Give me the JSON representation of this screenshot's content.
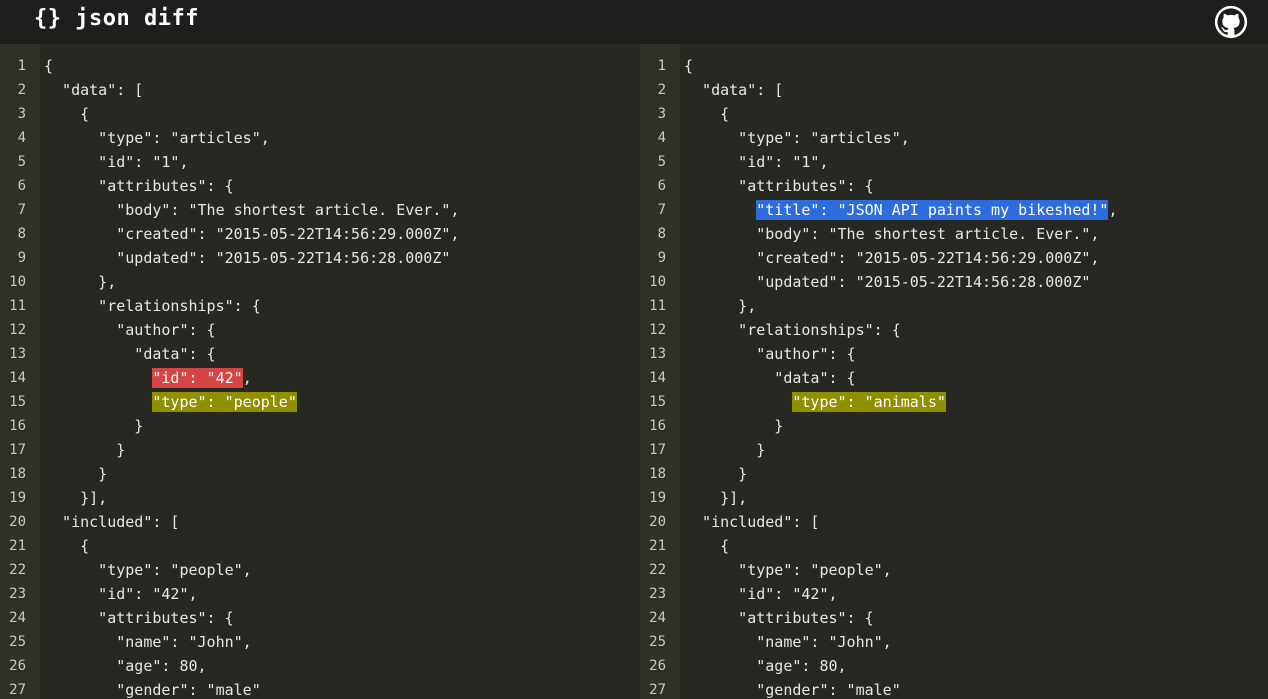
{
  "header": {
    "title": "{} json diff",
    "github_icon": "github-icon"
  },
  "colors": {
    "removed": "#d64545",
    "changed": "#8f8f00",
    "added": "#2d6cdf",
    "background": "#272822"
  },
  "left_pane": {
    "lines": [
      {
        "n": "1",
        "pre": "{",
        "hl": "",
        "post": "",
        "kind": ""
      },
      {
        "n": "2",
        "pre": "  \"data\": [",
        "hl": "",
        "post": "",
        "kind": ""
      },
      {
        "n": "3",
        "pre": "    {",
        "hl": "",
        "post": "",
        "kind": ""
      },
      {
        "n": "4",
        "pre": "      \"type\": \"articles\",",
        "hl": "",
        "post": "",
        "kind": ""
      },
      {
        "n": "5",
        "pre": "      \"id\": \"1\",",
        "hl": "",
        "post": "",
        "kind": ""
      },
      {
        "n": "6",
        "pre": "      \"attributes\": {",
        "hl": "",
        "post": "",
        "kind": ""
      },
      {
        "n": "7",
        "pre": "        \"body\": \"The shortest article. Ever.\",",
        "hl": "",
        "post": "",
        "kind": ""
      },
      {
        "n": "8",
        "pre": "        \"created\": \"2015-05-22T14:56:29.000Z\",",
        "hl": "",
        "post": "",
        "kind": ""
      },
      {
        "n": "9",
        "pre": "        \"updated\": \"2015-05-22T14:56:28.000Z\"",
        "hl": "",
        "post": "",
        "kind": ""
      },
      {
        "n": "10",
        "pre": "      },",
        "hl": "",
        "post": "",
        "kind": ""
      },
      {
        "n": "11",
        "pre": "      \"relationships\": {",
        "hl": "",
        "post": "",
        "kind": ""
      },
      {
        "n": "12",
        "pre": "        \"author\": {",
        "hl": "",
        "post": "",
        "kind": ""
      },
      {
        "n": "13",
        "pre": "          \"data\": {",
        "hl": "",
        "post": "",
        "kind": ""
      },
      {
        "n": "14",
        "pre": "            ",
        "hl": "\"id\": \"42\"",
        "post": ",",
        "kind": "removed"
      },
      {
        "n": "15",
        "pre": "            ",
        "hl": "\"type\": \"people\"",
        "post": "",
        "kind": "changed"
      },
      {
        "n": "16",
        "pre": "          }",
        "hl": "",
        "post": "",
        "kind": ""
      },
      {
        "n": "17",
        "pre": "        }",
        "hl": "",
        "post": "",
        "kind": ""
      },
      {
        "n": "18",
        "pre": "      }",
        "hl": "",
        "post": "",
        "kind": ""
      },
      {
        "n": "19",
        "pre": "    }],",
        "hl": "",
        "post": "",
        "kind": ""
      },
      {
        "n": "20",
        "pre": "  \"included\": [",
        "hl": "",
        "post": "",
        "kind": ""
      },
      {
        "n": "21",
        "pre": "    {",
        "hl": "",
        "post": "",
        "kind": ""
      },
      {
        "n": "22",
        "pre": "      \"type\": \"people\",",
        "hl": "",
        "post": "",
        "kind": ""
      },
      {
        "n": "23",
        "pre": "      \"id\": \"42\",",
        "hl": "",
        "post": "",
        "kind": ""
      },
      {
        "n": "24",
        "pre": "      \"attributes\": {",
        "hl": "",
        "post": "",
        "kind": ""
      },
      {
        "n": "25",
        "pre": "        \"name\": \"John\",",
        "hl": "",
        "post": "",
        "kind": ""
      },
      {
        "n": "26",
        "pre": "        \"age\": 80,",
        "hl": "",
        "post": "",
        "kind": ""
      },
      {
        "n": "27",
        "pre": "        \"gender\": \"male\"",
        "hl": "",
        "post": "",
        "kind": ""
      }
    ]
  },
  "right_pane": {
    "lines": [
      {
        "n": "1",
        "pre": "{",
        "hl": "",
        "post": "",
        "kind": ""
      },
      {
        "n": "2",
        "pre": "  \"data\": [",
        "hl": "",
        "post": "",
        "kind": ""
      },
      {
        "n": "3",
        "pre": "    {",
        "hl": "",
        "post": "",
        "kind": ""
      },
      {
        "n": "4",
        "pre": "      \"type\": \"articles\",",
        "hl": "",
        "post": "",
        "kind": ""
      },
      {
        "n": "5",
        "pre": "      \"id\": \"1\",",
        "hl": "",
        "post": "",
        "kind": ""
      },
      {
        "n": "6",
        "pre": "      \"attributes\": {",
        "hl": "",
        "post": "",
        "kind": ""
      },
      {
        "n": "7",
        "pre": "        ",
        "hl": "\"title\": \"JSON API paints my bikeshed!\"",
        "post": ",",
        "kind": "added"
      },
      {
        "n": "8",
        "pre": "        \"body\": \"The shortest article. Ever.\",",
        "hl": "",
        "post": "",
        "kind": ""
      },
      {
        "n": "9",
        "pre": "        \"created\": \"2015-05-22T14:56:29.000Z\",",
        "hl": "",
        "post": "",
        "kind": ""
      },
      {
        "n": "10",
        "pre": "        \"updated\": \"2015-05-22T14:56:28.000Z\"",
        "hl": "",
        "post": "",
        "kind": ""
      },
      {
        "n": "11",
        "pre": "      },",
        "hl": "",
        "post": "",
        "kind": ""
      },
      {
        "n": "12",
        "pre": "      \"relationships\": {",
        "hl": "",
        "post": "",
        "kind": ""
      },
      {
        "n": "13",
        "pre": "        \"author\": {",
        "hl": "",
        "post": "",
        "kind": ""
      },
      {
        "n": "14",
        "pre": "          \"data\": {",
        "hl": "",
        "post": "",
        "kind": ""
      },
      {
        "n": "15",
        "pre": "            ",
        "hl": "\"type\": \"animals\"",
        "post": "",
        "kind": "changed"
      },
      {
        "n": "16",
        "pre": "          }",
        "hl": "",
        "post": "",
        "kind": ""
      },
      {
        "n": "17",
        "pre": "        }",
        "hl": "",
        "post": "",
        "kind": ""
      },
      {
        "n": "18",
        "pre": "      }",
        "hl": "",
        "post": "",
        "kind": ""
      },
      {
        "n": "19",
        "pre": "    }],",
        "hl": "",
        "post": "",
        "kind": ""
      },
      {
        "n": "20",
        "pre": "  \"included\": [",
        "hl": "",
        "post": "",
        "kind": ""
      },
      {
        "n": "21",
        "pre": "    {",
        "hl": "",
        "post": "",
        "kind": ""
      },
      {
        "n": "22",
        "pre": "      \"type\": \"people\",",
        "hl": "",
        "post": "",
        "kind": ""
      },
      {
        "n": "23",
        "pre": "      \"id\": \"42\",",
        "hl": "",
        "post": "",
        "kind": ""
      },
      {
        "n": "24",
        "pre": "      \"attributes\": {",
        "hl": "",
        "post": "",
        "kind": ""
      },
      {
        "n": "25",
        "pre": "        \"name\": \"John\",",
        "hl": "",
        "post": "",
        "kind": ""
      },
      {
        "n": "26",
        "pre": "        \"age\": 80,",
        "hl": "",
        "post": "",
        "kind": ""
      },
      {
        "n": "27",
        "pre": "        \"gender\": \"male\"",
        "hl": "",
        "post": "",
        "kind": ""
      }
    ]
  }
}
